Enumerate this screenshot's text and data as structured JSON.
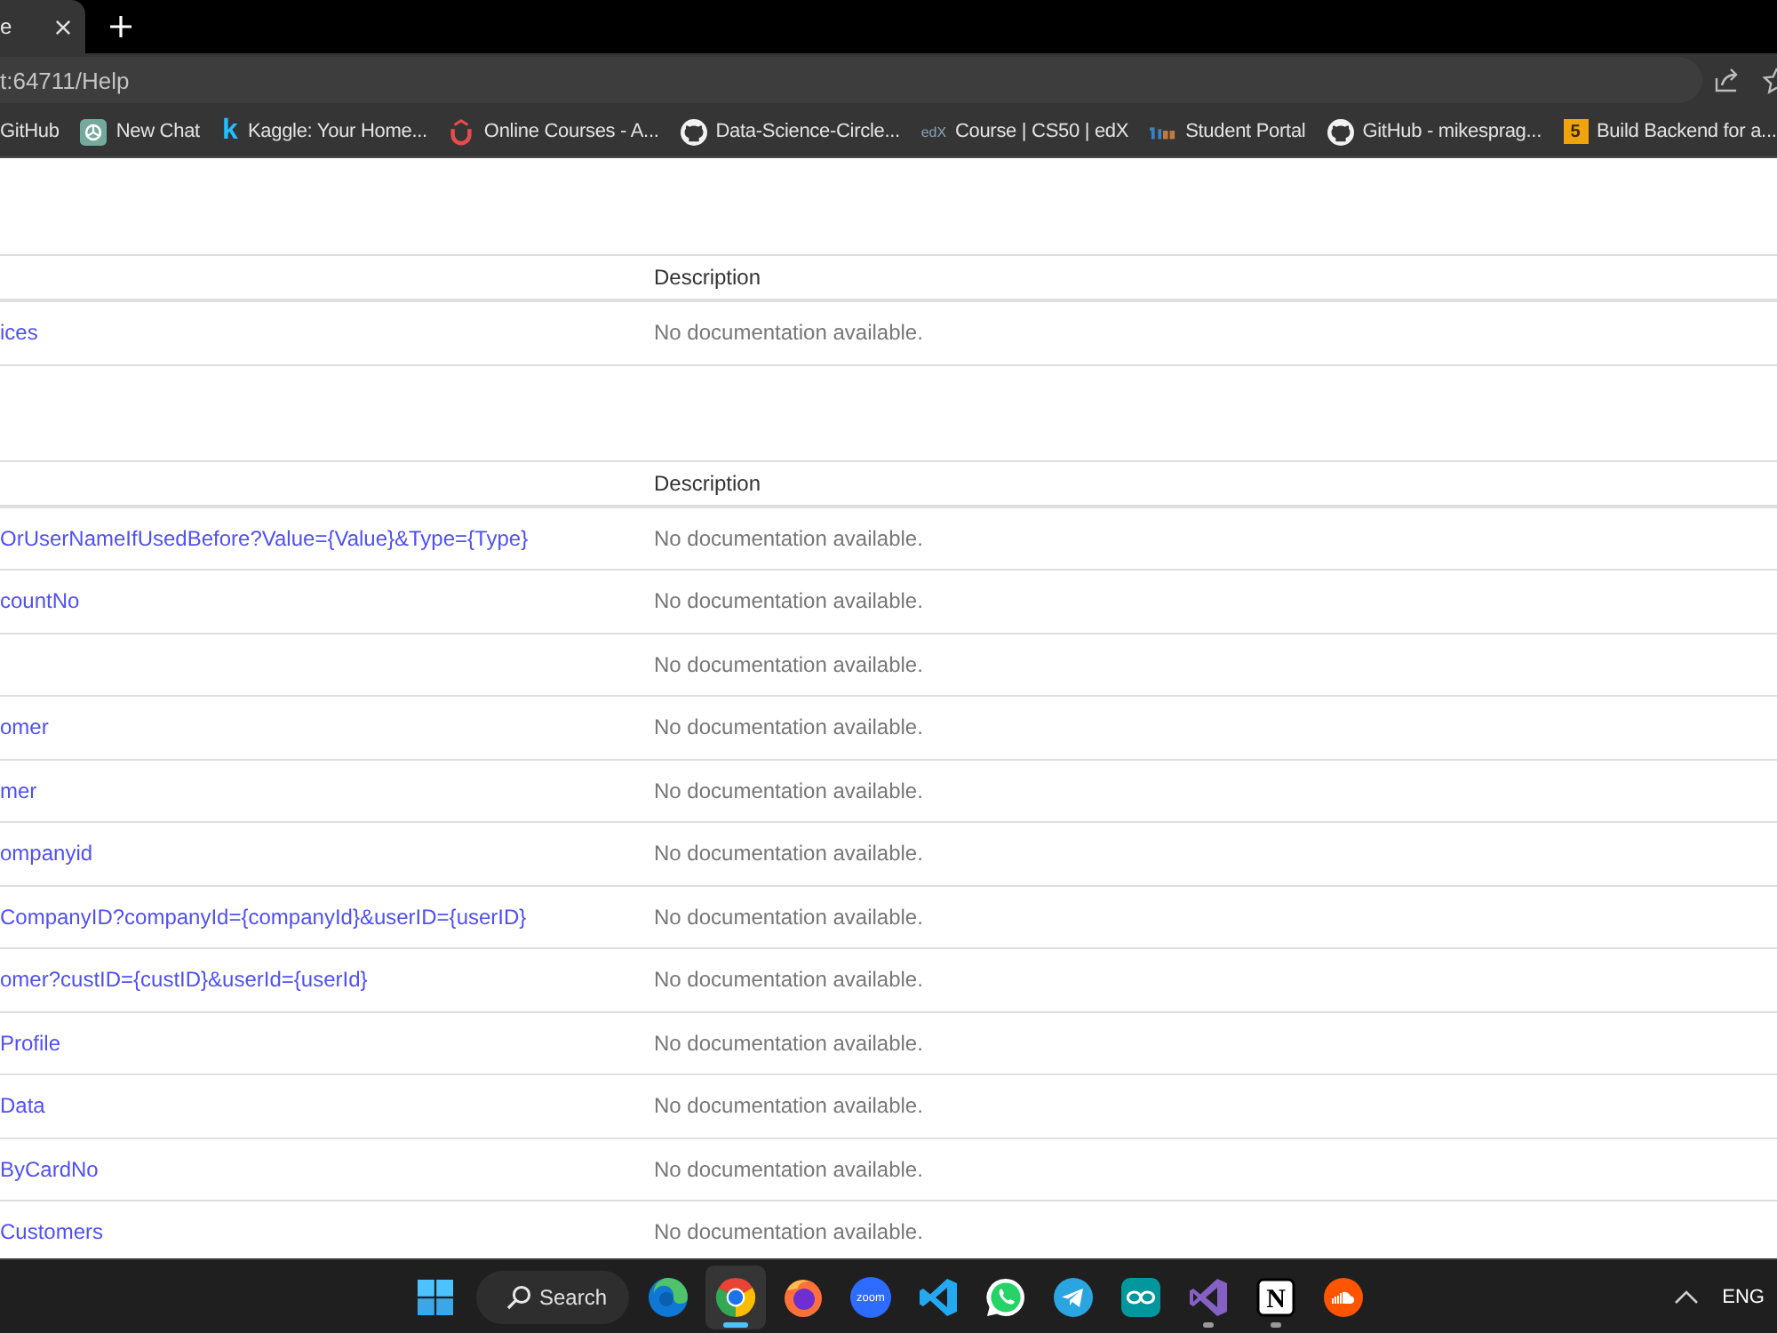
{
  "browser": {
    "tabs": [
      {
        "title": "e",
        "selected": true
      }
    ],
    "address": "t:64711/Help",
    "bookmarks": [
      {
        "kind": "none",
        "label": "GitHub"
      },
      {
        "kind": "openai",
        "label": "New Chat"
      },
      {
        "kind": "kaggle",
        "glyph": "k",
        "label": "Kaggle: Your Home..."
      },
      {
        "kind": "udemy",
        "label": "Online Courses - A..."
      },
      {
        "kind": "github",
        "label": "Data-Science-Circle..."
      },
      {
        "kind": "edx",
        "glyph": "edX",
        "label": "Course | CS50 | edX"
      },
      {
        "kind": "portal",
        "label": "Student Portal"
      },
      {
        "kind": "github",
        "label": "GitHub - mikesprag..."
      },
      {
        "kind": "number",
        "glyph": "5",
        "label": "Build Backend for a..."
      }
    ]
  },
  "page": {
    "tables": [
      {
        "header": "Description",
        "rows": [
          {
            "column_1": "ices",
            "description": "No documentation available."
          }
        ]
      },
      {
        "header": "Description",
        "rows": [
          {
            "column_1": "OrUserNameIfUsedBefore?Value={Value}&Type={Type}",
            "description": "No documentation available."
          },
          {
            "column_1": "countNo",
            "description": "No documentation available."
          },
          {
            "description": "No documentation available."
          },
          {
            "column_1": "omer",
            "description": "No documentation available."
          },
          {
            "column_1": "mer",
            "description": "No documentation available."
          },
          {
            "column_1": "ompanyid",
            "description": "No documentation available."
          },
          {
            "column_1": "CompanyID?companyId={companyId}&userID={userID}",
            "description": "No documentation available."
          },
          {
            "column_1": "omer?custID={custID}&userId={userId}",
            "description": "No documentation available."
          },
          {
            "column_1": "Profile",
            "description": "No documentation available."
          },
          {
            "column_1": "Data",
            "description": "No documentation available."
          },
          {
            "column_1": "ByCardNo",
            "description": "No documentation available."
          },
          {
            "column_1": "Customers",
            "description": "No documentation available."
          }
        ]
      }
    ]
  },
  "taskbar": {
    "search": "Search",
    "apps": [
      {
        "kind": "edge",
        "selected": false,
        "running": false
      },
      {
        "kind": "chrome",
        "selected": true,
        "running": true
      },
      {
        "kind": "firefox",
        "selected": false,
        "running": false
      },
      {
        "kind": "zoom",
        "glyph": "zoom",
        "selected": false,
        "running": false
      },
      {
        "kind": "vscode",
        "selected": false,
        "running": false
      },
      {
        "kind": "whatsapp",
        "selected": false,
        "running": false
      },
      {
        "kind": "telegram",
        "selected": false,
        "running": false
      },
      {
        "kind": "arduino",
        "selected": false,
        "running": false
      },
      {
        "kind": "visualstudio",
        "selected": false,
        "running": true
      },
      {
        "kind": "notion",
        "glyph": "N",
        "selected": false,
        "running": true
      },
      {
        "kind": "soundcloud",
        "selected": false,
        "running": false
      }
    ],
    "language": "ENG"
  }
}
